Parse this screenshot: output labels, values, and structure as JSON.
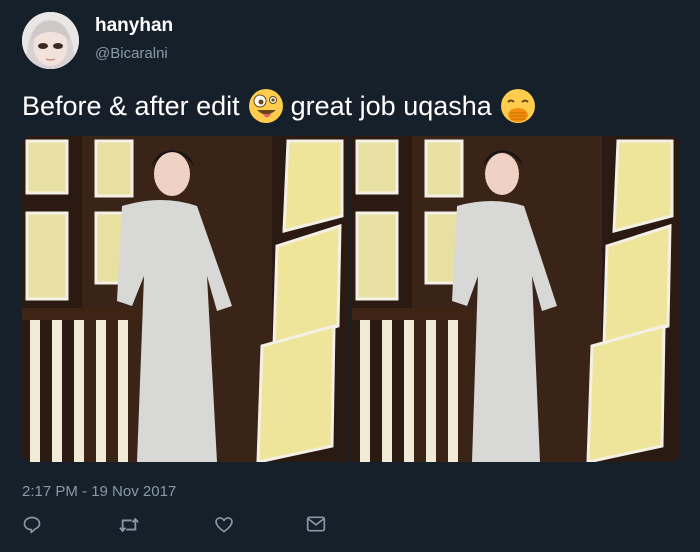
{
  "user": {
    "display_name": "hanyhan",
    "handle": "@Bicaralni"
  },
  "tweet": {
    "text_part1": "Before & after edit",
    "text_part2": "great job uqasha",
    "emoji_1": "zany-face-emoji",
    "emoji_2": "face-with-hand-over-mouth-emoji"
  },
  "media": {
    "photos": [
      {
        "label": "before"
      },
      {
        "label": "after"
      }
    ]
  },
  "timestamp": "2:17 PM - 19 Nov 2017",
  "actions": [
    "reply-icon",
    "retweet-icon",
    "like-icon",
    "dm-icon"
  ],
  "colors": {
    "background": "#15202b",
    "secondary_text": "#8899a6",
    "primary_text": "#ffffff"
  }
}
